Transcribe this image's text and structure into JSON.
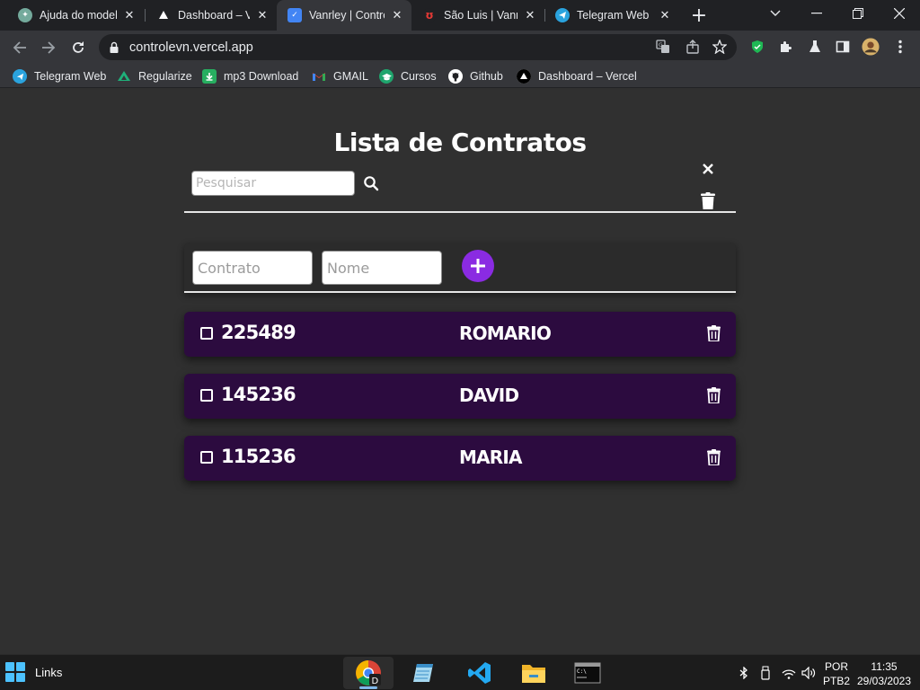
{
  "browser": {
    "tabs": [
      {
        "title": "Ajuda do model",
        "icon": "chatgpt-icon",
        "color": "#74aa9c"
      },
      {
        "title": "Dashboard – Ve",
        "icon": "vercel-icon",
        "color": "#ffffff"
      },
      {
        "title": "Vanrley | Contro",
        "icon": "checklist-icon",
        "color": "#4285f4"
      },
      {
        "title": "São Luis | Vanrle",
        "icon": "brand-icon",
        "color": "#e53935"
      },
      {
        "title": "Telegram Web",
        "icon": "telegram-icon",
        "color": "#2aa3de"
      }
    ],
    "active_tab_index": 2,
    "url": "controlevn.vercel.app",
    "bookmarks": [
      {
        "label": "Telegram Web",
        "icon": "telegram-icon",
        "color": "#2aa3de"
      },
      {
        "label": "Regularize",
        "icon": "regularize-icon",
        "color": "#1fb07a"
      },
      {
        "label": "mp3 Download",
        "icon": "download-icon",
        "color": "#27ae60"
      },
      {
        "label": "GMAIL",
        "icon": "gmail-icon",
        "color": "#ea4335"
      },
      {
        "label": "Cursos",
        "icon": "graduation-cap-icon",
        "color": "#1fa56d"
      },
      {
        "label": "Github",
        "icon": "github-icon",
        "color": "#ffffff"
      },
      {
        "label": "Dashboard – Vercel",
        "icon": "vercel-icon",
        "color": "#ffffff"
      }
    ]
  },
  "page": {
    "title": "Lista de Contratos",
    "search": {
      "placeholder": "Pesquisar",
      "value": ""
    },
    "form": {
      "contract_placeholder": "Contrato",
      "name_placeholder": "Nome",
      "add_label": "+"
    },
    "items": [
      {
        "contract": "225489",
        "name": "ROMARIO",
        "checked": false
      },
      {
        "contract": "145236",
        "name": "DAVID",
        "checked": false
      },
      {
        "contract": "115236",
        "name": "MARIA",
        "checked": false
      }
    ],
    "colors": {
      "background": "#303030",
      "item_bg": "#2c0b3f",
      "accent": "#8a2be2"
    }
  },
  "taskbar": {
    "links_label": "Links",
    "language": "POR",
    "layout": "PTB2",
    "time": "11:35",
    "date": "29/03/2023"
  }
}
